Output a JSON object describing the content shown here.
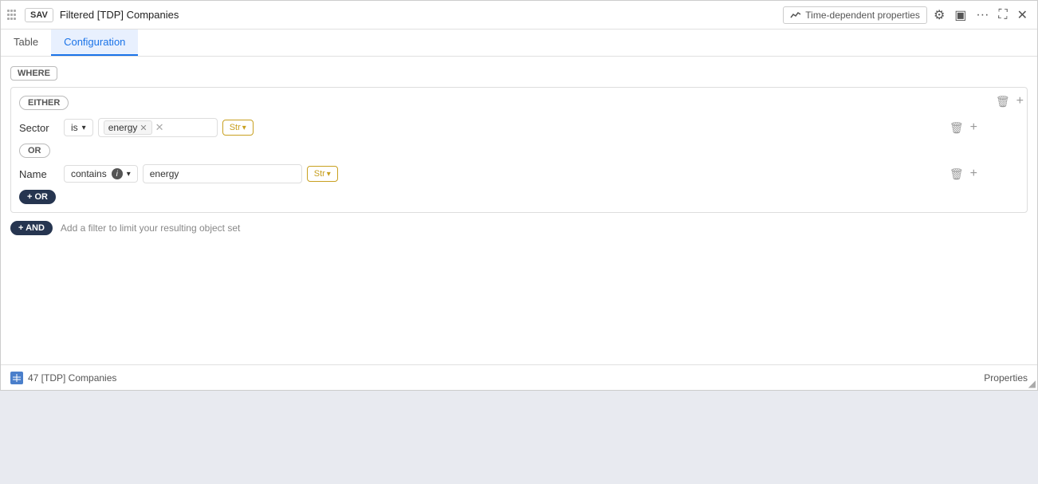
{
  "titleBar": {
    "saveLabel": "SAV",
    "title": "Filtered [TDP] Companies",
    "timeDependentLabel": "Time-dependent properties",
    "icons": {
      "gear": "⚙",
      "monitor": "🖥",
      "more": "···",
      "expand": "⛶",
      "close": "✕"
    }
  },
  "tabs": [
    {
      "id": "table",
      "label": "Table",
      "active": false
    },
    {
      "id": "configuration",
      "label": "Configuration",
      "active": true
    }
  ],
  "whereBadge": "WHERE",
  "filterGroup": {
    "eitherBadge": "EITHER",
    "rows": [
      {
        "id": "row1",
        "field": "Sector",
        "operator": "is",
        "value": "energy",
        "typeLabel": "Str"
      }
    ],
    "orBadge": "OR",
    "orRows": [
      {
        "id": "row2",
        "field": "Name",
        "operator": "contains",
        "value": "energy",
        "typeLabel": "Str",
        "hasInfo": true
      }
    ],
    "addOrBtn": "+ OR"
  },
  "addAndBtn": "+ AND",
  "addFilterHint": "Add a filter to limit your resulting object set",
  "footer": {
    "count": "47 [TDP] Companies",
    "propertiesLabel": "Properties"
  }
}
